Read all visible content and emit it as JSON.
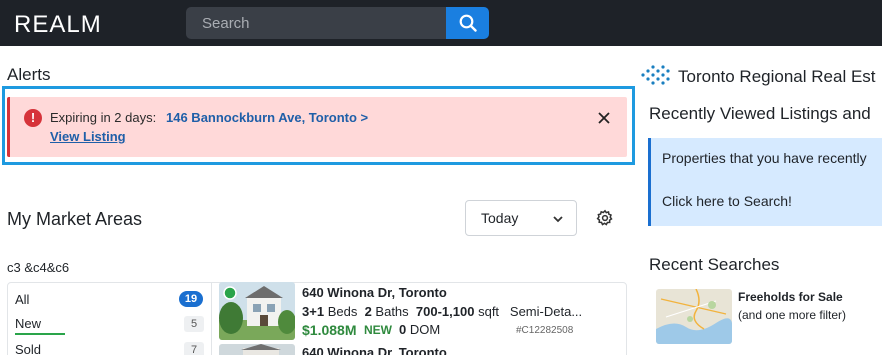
{
  "header": {
    "logo_text": "REALM",
    "search": {
      "placeholder": "Search",
      "value": ""
    }
  },
  "alerts": {
    "heading": "Alerts",
    "item": {
      "prefix": "Expiring in 2 days:",
      "address": "146 Bannockburn Ave, Toronto >",
      "view_label": "View Listing"
    }
  },
  "market": {
    "heading": "My Market Areas",
    "period": {
      "selected": "Today"
    },
    "area_name": "c3 &c4&c6",
    "filters": [
      {
        "label": "All",
        "count": "19"
      },
      {
        "label": "New",
        "count": "5"
      },
      {
        "label": "Sold",
        "count": "7"
      }
    ],
    "listings": [
      {
        "address": "640 Winona Dr, Toronto",
        "beds": "3+1",
        "beds_label": "Beds",
        "baths": "2",
        "baths_label": "Baths",
        "sqft": "700-1,100",
        "sqft_label": "sqft",
        "type": "Semi-Deta...",
        "price": "$1.088M",
        "status": "NEW",
        "dom": "0",
        "dom_label": "DOM",
        "mls": "#C12282508"
      },
      {
        "address": "640 Winona Dr, Toronto"
      }
    ]
  },
  "sidebar": {
    "board_name": "Toronto Regional Real Est",
    "recent_viewed": {
      "heading": "Recently Viewed Listings and",
      "line1": "Properties that you have recently",
      "line2": "Click here to Search!"
    },
    "recent_searches": {
      "heading": "Recent Searches",
      "item": {
        "title": "Freeholds for Sale",
        "subtitle": "(and one more filter)"
      }
    }
  },
  "colors": {
    "topbar": "#1e2228",
    "accent": "#1a7fe0",
    "alert_bg": "#ffd9d9",
    "alert_red": "#d6333a",
    "focus_ring": "#1e9ae0",
    "price_green": "#2f8a3e",
    "info_bg": "#d6eaff"
  },
  "icons": [
    "realm-logo",
    "search-icon",
    "error-icon",
    "close-icon",
    "chevron-down-icon",
    "gear-icon",
    "trreb-logo"
  ]
}
